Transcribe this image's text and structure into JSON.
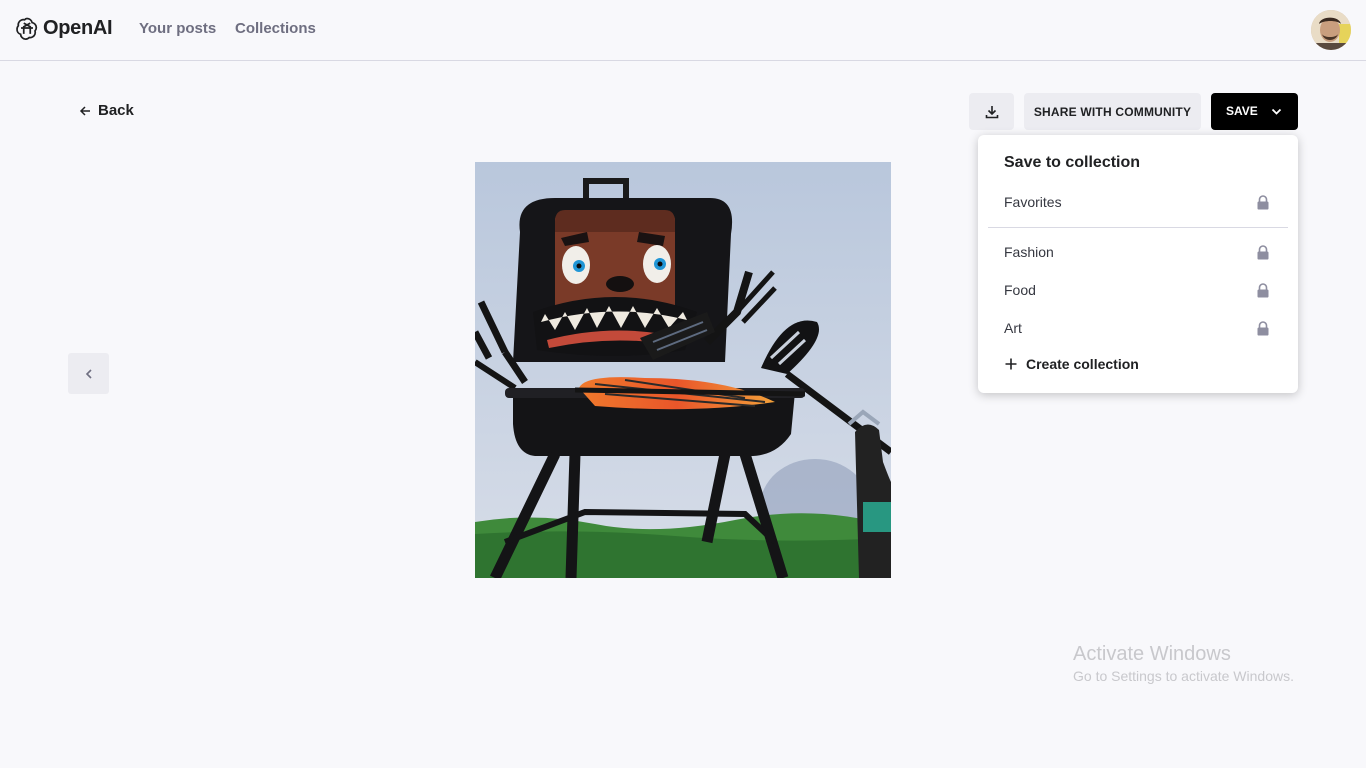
{
  "header": {
    "brand": "OpenAI",
    "nav": [
      {
        "label": "Your posts"
      },
      {
        "label": "Collections"
      }
    ]
  },
  "page": {
    "back_label": "Back"
  },
  "toolbar": {
    "download_icon": "download-icon",
    "share_label": "SHARE WITH COMMUNITY",
    "save_label": "SAVE"
  },
  "save_menu": {
    "title": "Save to collection",
    "collections": [
      {
        "label": "Favorites",
        "icon": "lock-icon"
      },
      {
        "label": "Fashion",
        "icon": "lock-icon"
      },
      {
        "label": "Food",
        "icon": "lock-icon"
      },
      {
        "label": "Art",
        "icon": "lock-icon"
      }
    ],
    "create_label": "Create collection"
  },
  "watermark": {
    "title": "Activate Windows",
    "subtitle": "Go to Settings to activate Windows."
  },
  "colors": {
    "background": "#f8f8fb",
    "button_gray": "#ececf1",
    "save_button": "#000000",
    "nav_text": "#6e6e80"
  }
}
